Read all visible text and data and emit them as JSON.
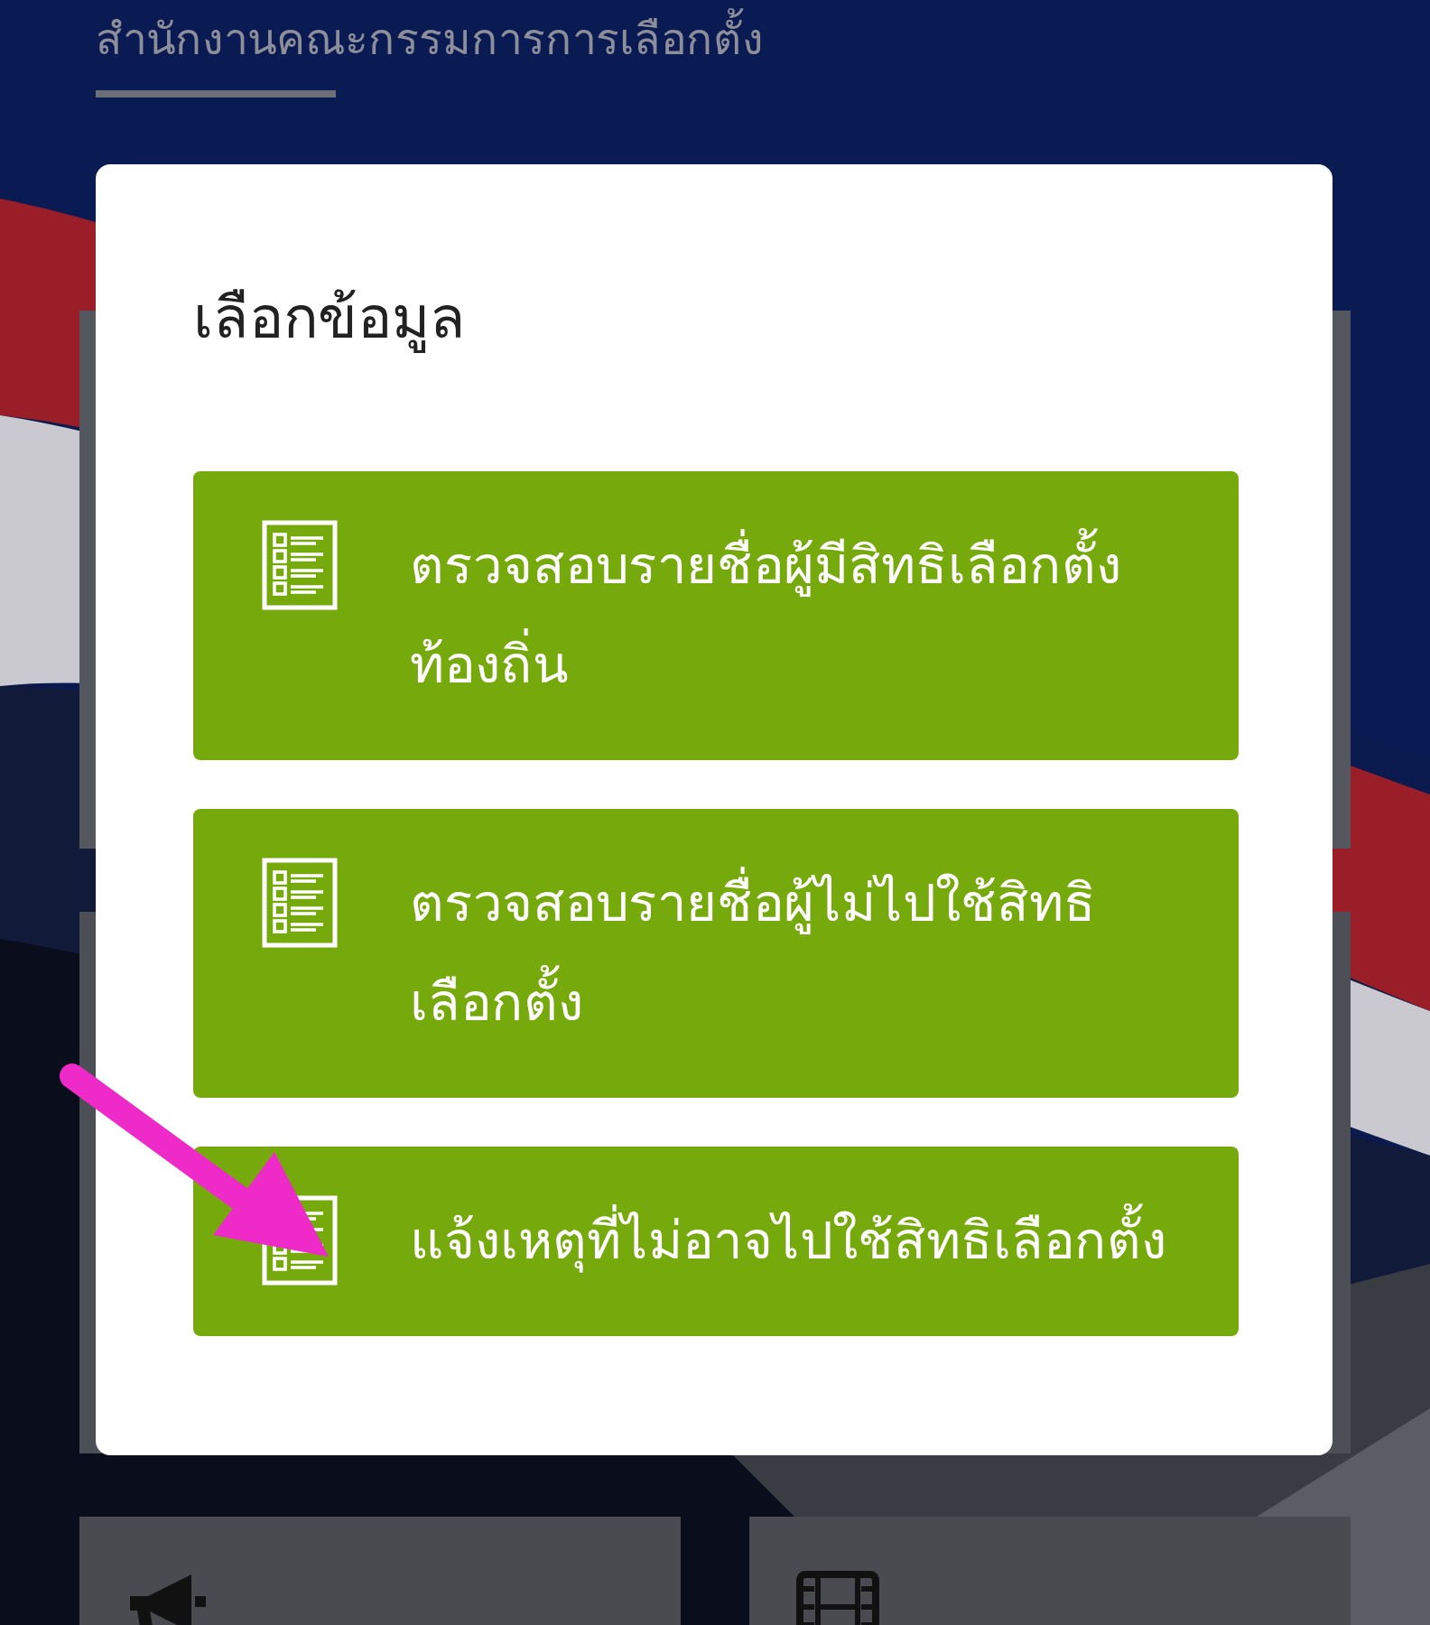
{
  "header": {
    "title": "สำนักงานคณะกรรมการการเลือกตั้ง"
  },
  "dialog": {
    "title": "เลือกข้อมูล",
    "options": [
      {
        "label": "ตรวจสอบรายชื่อผู้มีสิทธิเลือกตั้งท้องถิ่น"
      },
      {
        "label": "ตรวจสอบรายชื่อผู้ไม่ไปใช้สิทธิเลือกตั้ง"
      },
      {
        "label": "แจ้งเหตุที่ไม่อาจไปใช้สิทธิเลือกตั้ง"
      }
    ]
  },
  "tiles": [
    {
      "kind": "megaphone"
    },
    {
      "kind": "film"
    }
  ]
}
